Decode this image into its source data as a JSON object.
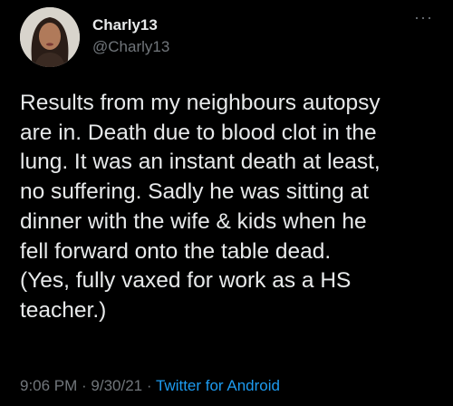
{
  "user": {
    "display_name": "Charly13",
    "handle": "@Charly13",
    "avatar_icon": "profile-photo"
  },
  "menu": {
    "icon": "more-options-icon",
    "glyph": "···"
  },
  "tweet": {
    "text": "Results from my neighbours autopsy\nare in. Death due to blood clot in the\nlung. It was an instant death at least,\nno suffering. Sadly he was sitting at\ndinner with the wife & kids when he\nfell forward onto the table dead.\n(Yes, fully vaxed for work as a HS\nteacher.)"
  },
  "meta": {
    "time": "9:06 PM",
    "separator": " · ",
    "date": "9/30/21",
    "source": "Twitter for Android"
  },
  "colors": {
    "background": "#000000",
    "text": "#e7e9ea",
    "muted": "#71767b",
    "link": "#1d9bf0"
  }
}
